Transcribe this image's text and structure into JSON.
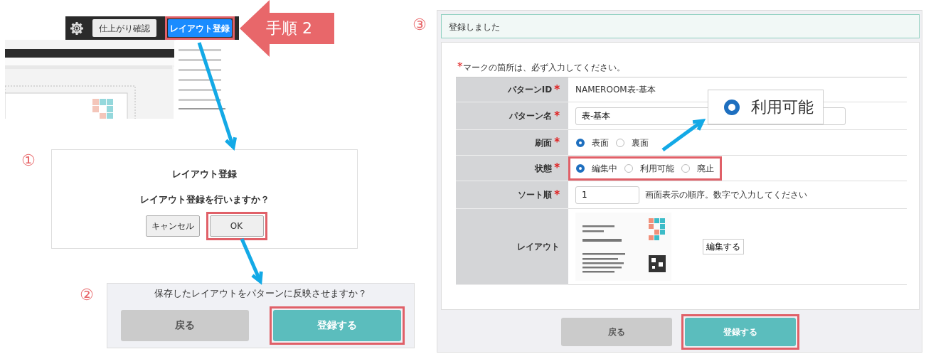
{
  "editor": {
    "buttons": [
      {
        "label": "仕上がり確認",
        "kind": "secondary",
        "highlighted": false
      },
      {
        "label": "レイアウト登録",
        "kind": "primary",
        "highlighted": true
      }
    ]
  },
  "step_callout": "手順 2",
  "dialog": {
    "number": "①",
    "title": "レイアウト登録",
    "message": "レイアウト登録を行いますか？",
    "buttons": [
      {
        "label": "キャンセル",
        "highlighted": false
      },
      {
        "label": "OK",
        "highlighted": true
      }
    ]
  },
  "confirm": {
    "number": "②",
    "message": "保存したレイアウトをパターンに反映させますか？",
    "buttons": [
      {
        "label": "戻る",
        "kind": "back",
        "highlighted": false
      },
      {
        "label": "登録する",
        "kind": "submit",
        "highlighted": true
      }
    ]
  },
  "form_panel": {
    "number": "③",
    "alert": "登録しました",
    "required_mark": "*",
    "required_note": "マークの箇所は、必ず入力してください。",
    "fields": [
      {
        "label": "パターンID",
        "mark": "*",
        "kind": "text",
        "value": "NAMEROOM表-基本"
      },
      {
        "label": "パターン名",
        "mark": "*",
        "kind": "input",
        "value": "表-基本"
      },
      {
        "label": "刷面",
        "mark": "*",
        "kind": "radio",
        "highlighted": false,
        "options": [
          {
            "label": "表面",
            "selected": true
          },
          {
            "label": "裏面",
            "selected": false
          }
        ]
      },
      {
        "label": "状態",
        "mark": "*",
        "kind": "radio",
        "highlighted": true,
        "options": [
          {
            "label": "編集中",
            "selected": true
          },
          {
            "label": "利用可能",
            "selected": false
          },
          {
            "label": "廃止",
            "selected": false
          }
        ]
      },
      {
        "label": "ソート順",
        "mark": "*",
        "kind": "input",
        "value": "1",
        "hint": "画面表示の順序。数字で入力してください"
      },
      {
        "label": "レイアウト",
        "kind": "layout",
        "button": "編集する"
      }
    ],
    "buttons": [
      {
        "label": "戻る",
        "kind": "back",
        "highlighted": false
      },
      {
        "label": "登録する",
        "kind": "submit",
        "highlighted": true
      }
    ]
  },
  "zoom_callout": {
    "label": "利用可能",
    "selected": true
  }
}
